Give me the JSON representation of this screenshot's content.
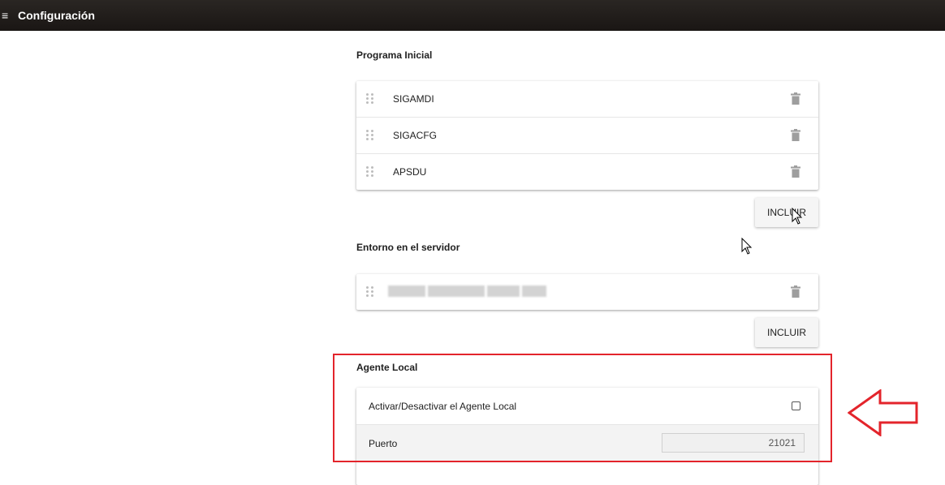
{
  "header": {
    "title": "Configuración",
    "menu_icon": "menu-icon"
  },
  "programa_inicial": {
    "title": "Programa Inicial",
    "items": [
      {
        "label": "SIGAMDI"
      },
      {
        "label": "SIGACFG"
      },
      {
        "label": "APSDU"
      }
    ],
    "add_button": "INCLUIR"
  },
  "entorno": {
    "title": "Entorno en el servidor",
    "add_button": "INCLUIR"
  },
  "agente_local": {
    "title": "Agente Local",
    "toggle_label": "Activar/Desactivar el Agente Local",
    "toggle_checked": false,
    "port_label": "Puerto",
    "port_value": "21021"
  },
  "colors": {
    "highlight": "#e3242b",
    "topbar": "#1f1b19"
  }
}
